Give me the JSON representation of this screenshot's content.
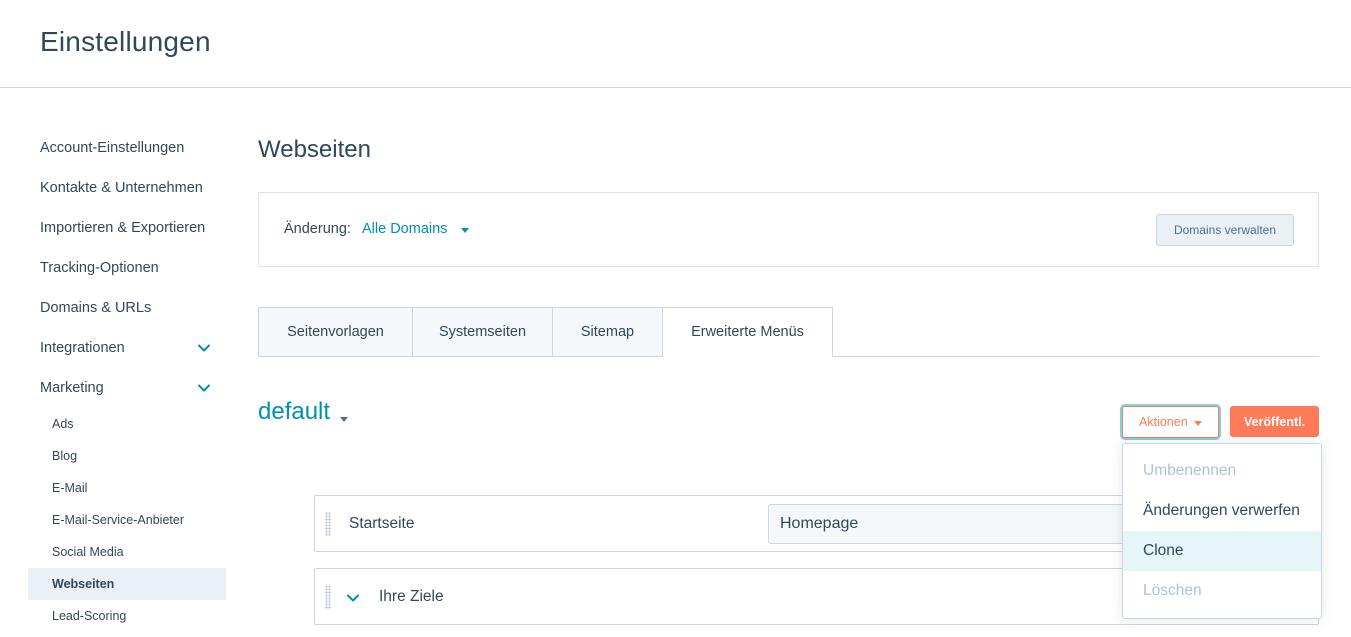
{
  "header": {
    "title": "Einstellungen"
  },
  "sidebar": {
    "items": [
      {
        "label": "Account-Einstellungen"
      },
      {
        "label": "Kontakte & Unternehmen"
      },
      {
        "label": "Importieren & Exportieren"
      },
      {
        "label": "Tracking-Optionen"
      },
      {
        "label": "Domains & URLs"
      },
      {
        "label": "Integrationen",
        "expandable": true
      },
      {
        "label": "Marketing",
        "expandable": true
      }
    ],
    "sub_items": [
      {
        "label": "Ads"
      },
      {
        "label": "Blog"
      },
      {
        "label": "E-Mail"
      },
      {
        "label": "E-Mail-Service-Anbieter"
      },
      {
        "label": "Social Media"
      },
      {
        "label": "Webseiten",
        "active": true
      },
      {
        "label": "Lead-Scoring"
      }
    ]
  },
  "main": {
    "title": "Webseiten",
    "domain_filter": {
      "label": "Änderung:",
      "value": "Alle Domains",
      "manage_button": "Domains verwalten"
    },
    "tabs": [
      {
        "label": "Seitenvorlagen"
      },
      {
        "label": "Systemseiten"
      },
      {
        "label": "Sitemap"
      },
      {
        "label": "Erweiterte Menüs",
        "active": true
      }
    ],
    "menu": {
      "name": "default",
      "actions_button": "Aktionen",
      "publish_button": "Veröffentl."
    },
    "menu_rows": [
      {
        "label": "Startseite",
        "input_value": "Homepage"
      },
      {
        "label": "Ihre Ziele"
      }
    ],
    "actions_menu": [
      {
        "label": "Umbenennen",
        "disabled": true
      },
      {
        "label": "Änderungen verwerfen",
        "disabled": false
      },
      {
        "label": "Clone",
        "disabled": false,
        "hover": true
      },
      {
        "label": "Löschen",
        "disabled": true
      }
    ]
  },
  "colors": {
    "accent": "#0091ae",
    "primary_button": "#ff7a59",
    "text": "#33475b",
    "border": "#cbd6e2"
  }
}
